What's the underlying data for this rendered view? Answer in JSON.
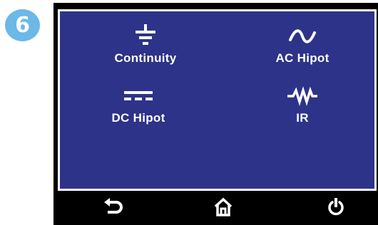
{
  "badge": {
    "number": "6",
    "color": "#6cb8e6"
  },
  "screen": {
    "background": "#2d3389",
    "modes": [
      {
        "label": "Continuity",
        "icon": "ground-icon"
      },
      {
        "label": "AC  Hipot",
        "icon": "ac-sine-icon"
      },
      {
        "label": "DC  Hipot",
        "icon": "dc-symbol-icon"
      },
      {
        "label": "IR",
        "icon": "resistor-icon"
      }
    ]
  },
  "nav": {
    "back": {
      "icon": "back-arrow-icon"
    },
    "home": {
      "icon": "home-icon"
    },
    "power": {
      "icon": "power-icon"
    }
  }
}
